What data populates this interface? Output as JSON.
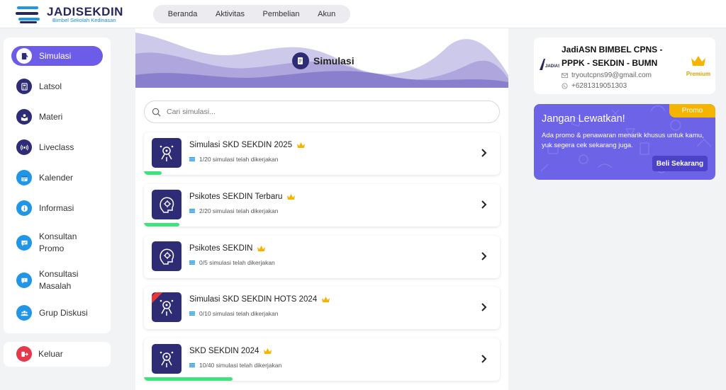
{
  "brand": {
    "title": "JADISEKDIN",
    "subtitle": "Bimbel Sekolah Kedinasan"
  },
  "topnav": [
    {
      "label": "Beranda"
    },
    {
      "label": "Aktivitas"
    },
    {
      "label": "Pembelian"
    },
    {
      "label": "Akun"
    }
  ],
  "sidebar": {
    "items": [
      {
        "label": "Simulasi",
        "icon": "simulasi-icon",
        "active": true
      },
      {
        "label": "Latsol",
        "icon": "calculator-icon"
      },
      {
        "label": "Materi",
        "icon": "book-icon"
      },
      {
        "label": "Liveclass",
        "icon": "broadcast-icon"
      },
      {
        "label": "Kalender",
        "icon": "calendar-icon"
      },
      {
        "label": "Informasi",
        "icon": "info-icon"
      },
      {
        "label": "Konsultan Promo",
        "icon": "chat-icon"
      },
      {
        "label": "Konsultasi Masalah",
        "icon": "chat-question-icon"
      },
      {
        "label": "Grup Diskusi",
        "icon": "group-icon"
      }
    ],
    "logout_label": "Keluar"
  },
  "main": {
    "title": "Simulasi",
    "search_placeholder": "Cari simulasi...",
    "cards": [
      {
        "title": "Simulasi SKD SEKDIN 2025",
        "meta": "1/20 simulasi telah dikerjakan",
        "done": 1,
        "total": 20,
        "premium": true
      },
      {
        "title": "Psikotes SEKDIN Terbaru",
        "meta": "2/20 simulasi telah dikerjakan",
        "done": 2,
        "total": 20,
        "premium": true
      },
      {
        "title": "Psikotes SEKDIN",
        "meta": "0/5 simulasi telah dikerjakan",
        "done": 0,
        "total": 5,
        "premium": true
      },
      {
        "title": "Simulasi SKD SEKDIN HOTS 2024",
        "meta": "0/10 simulasi telah dikerjakan",
        "done": 0,
        "total": 10,
        "premium": true
      },
      {
        "title": "SKD SEKDIN 2024",
        "meta": "10/40 simulasi telah dikerjakan",
        "done": 10,
        "total": 40,
        "premium": true
      }
    ]
  },
  "profile": {
    "name": "JadiASN BIMBEL CPNS - PPPK - SEKDIN - BUMN",
    "email": "tryoutcpns99@gmail.com",
    "phone": "+6281319051303",
    "badge": "Premium"
  },
  "promo": {
    "tag": "Promo",
    "title": "Jangan Lewatkan!",
    "description": "Ada promo & penawaran menarik khusus untuk kamu, yuk segera cek sekarang juga.",
    "button": "Beli Sekarang"
  },
  "colors": {
    "accent": "#6c5ce7",
    "navy": "#2e2c75",
    "progress": "#3ee37d",
    "premium": "#f5b400",
    "danger": "#e6384b"
  }
}
